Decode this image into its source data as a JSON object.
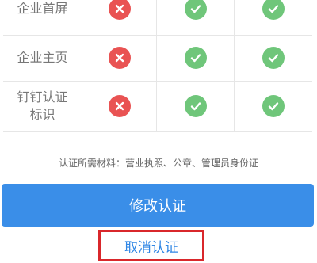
{
  "feature_table": {
    "rows": [
      {
        "label": "企业首屏",
        "basic": "cross",
        "standard": "check",
        "premium": "check"
      },
      {
        "label": "企业主页",
        "basic": "cross",
        "standard": "check",
        "premium": "check"
      },
      {
        "label": "钉钉认证标识",
        "basic": "cross",
        "standard": "check",
        "premium": "check"
      }
    ],
    "status_colors": {
      "cross": "#e95353",
      "check": "#6fc67a"
    }
  },
  "materials_note": "认证所需材料：营业执照、公章、管理员身份证",
  "actions": {
    "modify_label": "修改认证",
    "cancel_label": "取消认证"
  },
  "colors": {
    "primary": "#3a8ee8",
    "link": "#2f86e5",
    "highlight_border": "#d9272b"
  }
}
